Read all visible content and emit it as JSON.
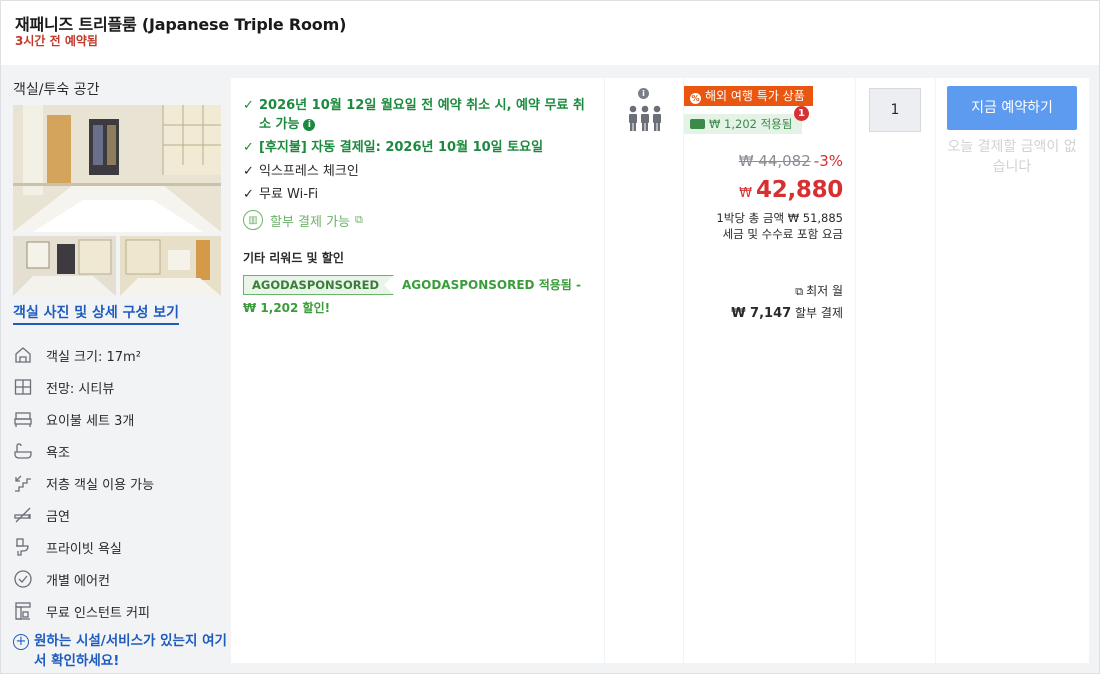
{
  "header": {
    "room_title": "재패니즈 트리플룸 (Japanese Triple Room)",
    "booked_ago": "3시간 전 예약됨"
  },
  "left": {
    "section_title": "객실/투숙 공간",
    "photos_link": "객실 사진 및 상세 구성 보기",
    "features": [
      {
        "icon": "room-size-icon",
        "label": "객실 크기: 17m²"
      },
      {
        "icon": "view-window-icon",
        "label": "전망: 시티뷰"
      },
      {
        "icon": "futon-bed-icon",
        "label": "요이불 세트 3개"
      },
      {
        "icon": "bathtub-icon",
        "label": "욕조"
      },
      {
        "icon": "low-floor-icon",
        "label": "저층 객실 이용 가능"
      },
      {
        "icon": "no-smoking-icon",
        "label": "금연"
      },
      {
        "icon": "private-bathroom-icon",
        "label": "프라이빗 욕실"
      },
      {
        "icon": "air-conditioner-icon",
        "label": "개별 에어컨"
      },
      {
        "icon": "coffee-maker-icon",
        "label": "무료 인스턴트 커피"
      }
    ],
    "more_link": "원하는 시설/서비스가 있는지 여기서 확인하세요!"
  },
  "benefits": {
    "cancel_line": "2026년 10월 12일 월요일 전 예약 취소 시, 예약 무료 취소 가능",
    "autopay_line": "[후지불] 자동 결제일: 2026년 10월 10일 토요일",
    "express": "익스프레스 체크인",
    "wifi": "무료 Wi-Fi",
    "installment": "할부 결제 가능",
    "other_title": "기타 리워드 및 할인",
    "promo_code": "AGODASPONSORED",
    "promo_text": "AGODASPONSORED 적용됨 - ₩ 1,202 할인!"
  },
  "price": {
    "deal_badge": "해외 여행 특가 상품",
    "coupon": "₩ 1,202 적용됨",
    "coupon_count": "1",
    "original": "₩ 44,082",
    "discount": "-3%",
    "currency": "₩",
    "final": "42,880",
    "per_night": "1박당 총 금액 ₩ 51,885",
    "tax_note": "세금 및 수수료 포함 요금",
    "min_label": "최저 월",
    "min_amount": "₩ 7,147",
    "min_suffix": "할부 결제"
  },
  "quantity": {
    "value": "1"
  },
  "booking": {
    "button": "지금 예약하기",
    "no_pay_note": "오늘 결제할 금액이 없습니다"
  },
  "colors": {
    "accent_blue": "#5c9bf0",
    "link_blue": "#1e5bbf",
    "price_red": "#d63031",
    "deal_orange": "#e8560f",
    "benefit_green": "#1b8a3e"
  }
}
